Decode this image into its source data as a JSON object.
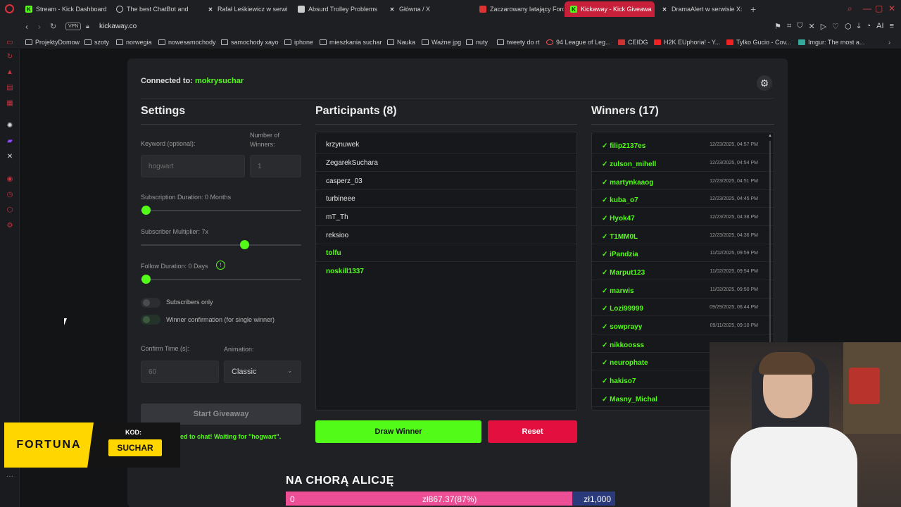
{
  "browser": {
    "tabs": [
      {
        "title": "Stream - Kick Dashboard",
        "active": false
      },
      {
        "title": "The best ChatBot and",
        "active": false
      },
      {
        "title": "Rafał Leśkiewicz w serwi",
        "active": false
      },
      {
        "title": "Absurd Trolley Problems",
        "active": false
      },
      {
        "title": "Główna / X",
        "active": false
      },
      {
        "title": "Zaczarowany latający Ford",
        "active": false
      },
      {
        "title": "Kickaway - Kick Giveawa",
        "active": true
      },
      {
        "title": "DramaAlert w serwisie X:",
        "active": false
      }
    ],
    "vpn_label": "VPN",
    "url": "kickaway.co",
    "ai_label": "AI",
    "bookmarks": [
      "ProjektyDomow",
      "szoty",
      "norwegia",
      "nowesamochody",
      "samochody xayo",
      "iphone",
      "mieszkania suchar",
      "Nauka",
      "Ważne jpg",
      "nuty",
      "tweety do rt",
      "94 League of Leg...",
      "CEIDG",
      "H2K EUphoria! - Y...",
      "Tylko Gucio - Cov...",
      "Imgur: The most a..."
    ]
  },
  "app": {
    "connected_label": "Connected to:",
    "connected_user": "mokrysuchar",
    "settings": {
      "heading": "Settings",
      "keyword_label": "Keyword (optional):",
      "keyword_placeholder": "hogwart",
      "winners_label": "Number of Winners:",
      "winners_placeholder": "1",
      "sub_duration_label": "Subscription Duration: 0 Months",
      "sub_duration_value": 0,
      "sub_multiplier_label": "Subscriber Multiplier: 7x",
      "sub_multiplier_value": 7,
      "follow_duration_label": "Follow Duration: 0 Days",
      "follow_duration_value": 0,
      "subscribers_only_label": "Subscribers only",
      "winner_confirmation_label": "Winner confirmation (for single winner)",
      "confirm_time_label": "Confirm Time (s):",
      "confirm_time_placeholder": "60",
      "animation_label": "Animation:",
      "animation_value": "Classic",
      "start_button": "Start Giveaway",
      "status_text": "ed to chat! Waiting for \"hogwart\"."
    },
    "participants": {
      "heading": "Participants (8)",
      "items": [
        {
          "name": "krzynuwek",
          "highlight": false
        },
        {
          "name": "ZegarekSuchara",
          "highlight": false
        },
        {
          "name": "casperz_03",
          "highlight": false
        },
        {
          "name": "turbineee",
          "highlight": false
        },
        {
          "name": "mT_Th",
          "highlight": false
        },
        {
          "name": "reksioo",
          "highlight": false
        },
        {
          "name": "tolfu",
          "highlight": true
        },
        {
          "name": "noskill1337",
          "highlight": true
        }
      ]
    },
    "winners": {
      "heading": "Winners (17)",
      "items": [
        {
          "name": "✓ filip2137es",
          "date": "12/23/2025, 04:57 PM"
        },
        {
          "name": "✓ zulson_mihell",
          "date": "12/23/2025, 04:54 PM"
        },
        {
          "name": "✓ martynkaaog",
          "date": "12/23/2025, 04:51 PM"
        },
        {
          "name": "✓ kuba_o7",
          "date": "12/23/2025, 04:45 PM"
        },
        {
          "name": "✓ Hyok47",
          "date": "12/23/2025, 04:38 PM"
        },
        {
          "name": "✓ T1MM0L",
          "date": "12/23/2025, 04:36 PM"
        },
        {
          "name": "✓ iPandzia",
          "date": "11/02/2025, 09:59 PM"
        },
        {
          "name": "✓ Marput123",
          "date": "11/02/2025, 09:54 PM"
        },
        {
          "name": "✓ marwis",
          "date": "11/02/2025, 09:50 PM"
        },
        {
          "name": "✓ Lozi99999",
          "date": "09/29/2025, 06:44 PM"
        },
        {
          "name": "✓ sowprayy",
          "date": "09/11/2025, 09:10 PM"
        },
        {
          "name": "✓ nikkoosss",
          "date": ""
        },
        {
          "name": "✓ neurophate",
          "date": ""
        },
        {
          "name": "✓ hakiso7",
          "date": ""
        },
        {
          "name": "✓ Masny_Michal",
          "date": ""
        }
      ]
    },
    "draw_button": "Draw Winner",
    "reset_button": "Reset"
  },
  "overlay": {
    "fortuna_logo": "FORTUNA",
    "code_label": "KOD:",
    "code_value": "SUCHAR",
    "stream_title": "NA CHORĄ ALICJĘ",
    "goal_left": "0",
    "goal_current": "zł867.37(87%)",
    "goal_right": "zł1,000",
    "goal_fraction": 0.87
  },
  "colors": {
    "accent": "#53fc18",
    "reset": "#e3103f",
    "opera": "#e0303d"
  }
}
